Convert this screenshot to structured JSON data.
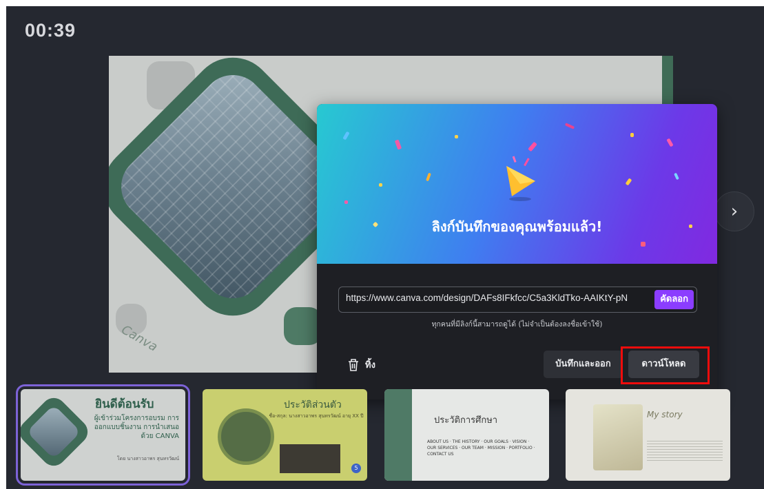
{
  "timer": "00:39",
  "modal": {
    "title": "ลิงก์บันทึกของคุณพร้อมแล้ว!",
    "link_url": "https://www.canva.com/design/DAFs8IFkfcc/C5a3KldTko-AAIKtY-pN",
    "copy_label": "คัดลอก",
    "note": "ทุกคนที่มีลิงก์นี้สามารถดูได้ (ไม่จำเป็นต้องลงชื่อเข้าใช้)",
    "delete_label": "ทิ้ง",
    "save_exit_label": "บันทึกและออก",
    "download_label": "ดาวน์โหลด"
  },
  "slide": {
    "watermark": "Canva"
  },
  "thumbnails": [
    {
      "title": "ยินดีต้อนรับ",
      "subtitle": "ผู้เข้าร่วมโครงการอบรม การออกแบบชิ้นงาน การนำเสนอด้วย CANVA",
      "byline": "โดย นางสาวอาพร สุนทรวัฒน์"
    },
    {
      "title": "ประวัติส่วนตัว",
      "lines": "ชื่อ-สกุล: นางสาวอาพร สุนทรวัฒน์ อายุ XX ปี",
      "badge": "5"
    },
    {
      "title": "ประวัติการศึกษา",
      "items": "ABOUT US · THE HISTORY · OUR GOALS · VISION · OUR SERVICES · OUR TEAM · MISSION · PORTFOLIO · CONTACT US"
    },
    {
      "title": "My story"
    }
  ],
  "colors": {
    "accent_purple": "#8b3dff",
    "highlight_red": "#f00c0c",
    "selected_outline": "#7d63d8"
  }
}
